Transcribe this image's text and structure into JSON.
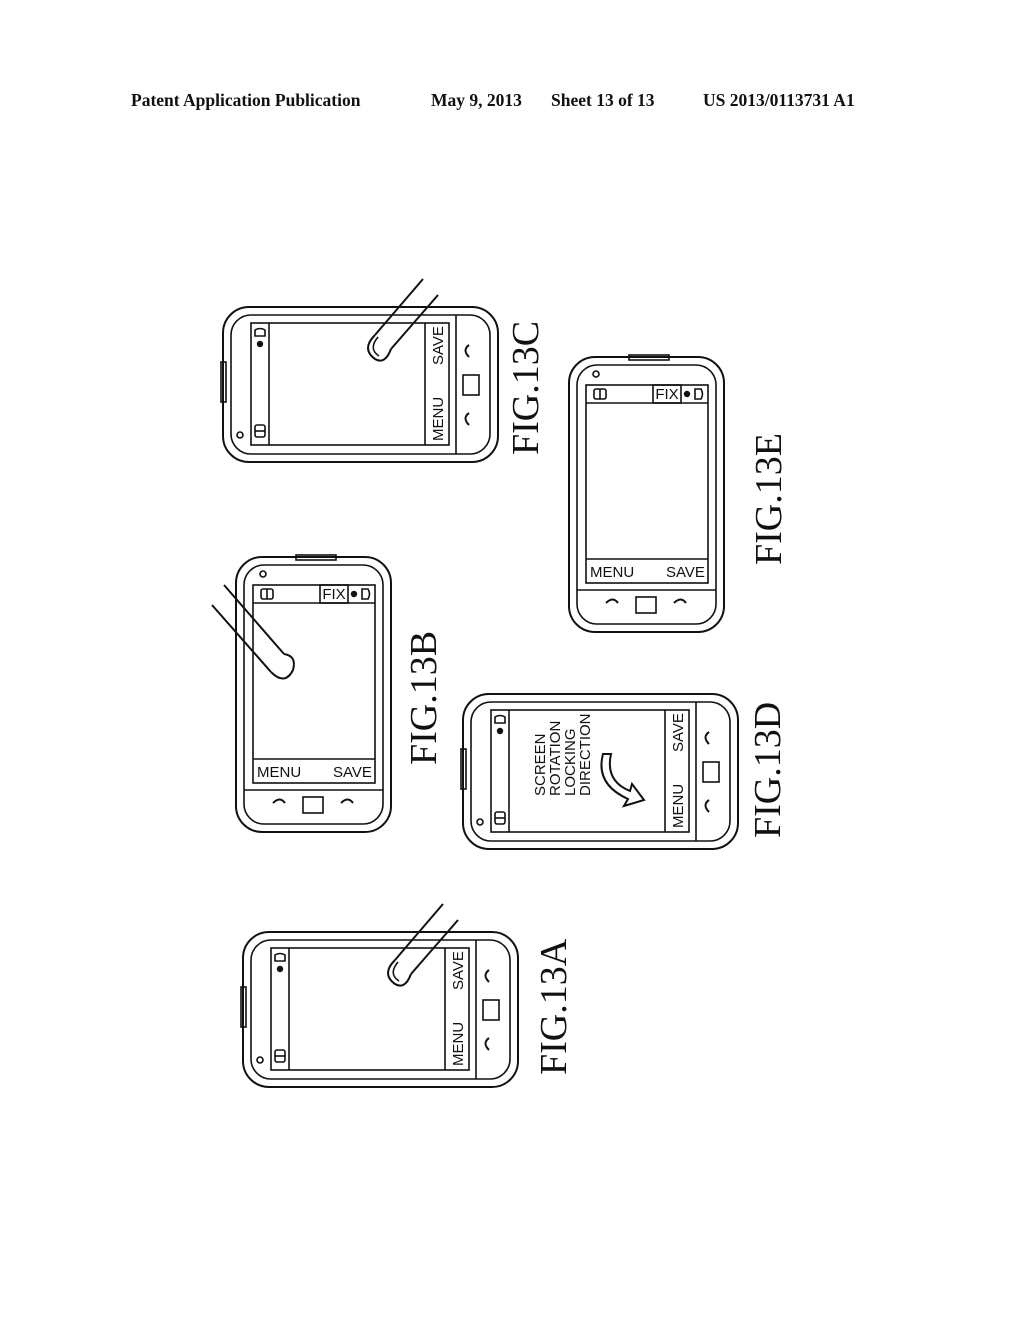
{
  "header": {
    "publication": "Patent Application Publication",
    "date": "May 9, 2013",
    "sheet": "Sheet 13 of 13",
    "number": "US 2013/0113731 A1"
  },
  "figures": [
    {
      "id": "13A",
      "label": "FIG.13A",
      "orientation": "landscape-rotated",
      "softkeys": {
        "left": "MENU",
        "right": "SAVE"
      },
      "status_icons": [
        "bell-icon",
        "lock-icon",
        "battery-icon"
      ],
      "fix_button": null,
      "finger_touch": true,
      "message": null
    },
    {
      "id": "13B",
      "label": "FIG.13B",
      "orientation": "portrait-upside-down",
      "softkeys": {
        "left": "MENU",
        "right": "SAVE"
      },
      "status_icons": [
        "bell-icon",
        "lock-icon",
        "battery-icon"
      ],
      "fix_button": "FIX",
      "finger_touch": true,
      "message": null
    },
    {
      "id": "13C",
      "label": "FIG.13C",
      "orientation": "landscape-rotated",
      "softkeys": {
        "left": "MENU",
        "right": "SAVE"
      },
      "status_icons": [
        "bell-icon",
        "lock-icon",
        "battery-icon"
      ],
      "fix_button": null,
      "finger_touch": true,
      "message": null
    },
    {
      "id": "13D",
      "label": "FIG.13D",
      "orientation": "landscape-rotated",
      "softkeys": {
        "left": "MENU",
        "right": "SAVE"
      },
      "status_icons": [
        "bell-icon",
        "lock-icon",
        "battery-icon"
      ],
      "fix_button": null,
      "finger_touch": false,
      "message": [
        "SCREEN",
        "ROTATION",
        "LOCKING",
        "DIRECTION"
      ],
      "message_arrow": "curved-arrow-icon"
    },
    {
      "id": "13E",
      "label": "FIG.13E",
      "orientation": "portrait-upside-down",
      "softkeys": {
        "left": "MENU",
        "right": "SAVE"
      },
      "status_icons": [
        "bell-icon",
        "lock-icon",
        "battery-icon"
      ],
      "fix_button": "FIX",
      "finger_touch": false,
      "message": null
    }
  ]
}
